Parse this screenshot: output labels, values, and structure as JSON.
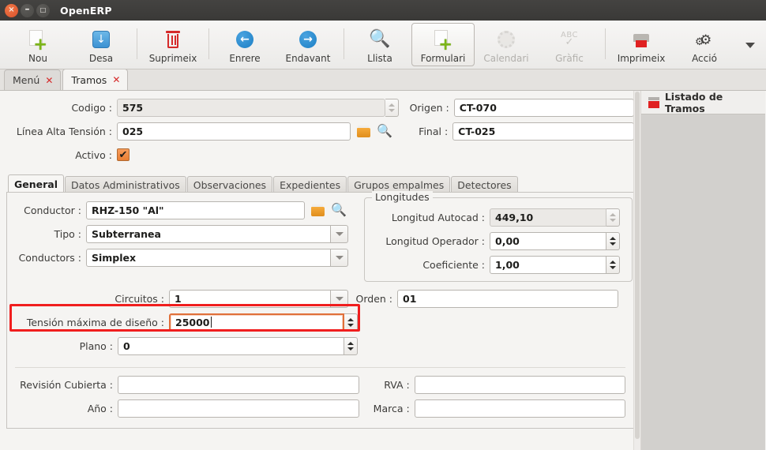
{
  "window": {
    "title": "OpenERP",
    "buttons": [
      {
        "name": "close",
        "glyph": "×"
      },
      {
        "name": "minimize",
        "glyph": "–"
      },
      {
        "name": "maximize",
        "glyph": "□"
      }
    ]
  },
  "toolbar": {
    "items": [
      {
        "label": "Nou",
        "icon": "new-document-icon",
        "enabled": true,
        "active": false
      },
      {
        "label": "Desa",
        "icon": "save-icon",
        "enabled": true,
        "active": false
      },
      {
        "label": "Suprimeix",
        "icon": "trash-icon",
        "enabled": true,
        "active": false
      },
      {
        "label": "Enrere",
        "icon": "arrow-left-icon",
        "enabled": true,
        "active": false
      },
      {
        "label": "Endavant",
        "icon": "arrow-right-icon",
        "enabled": true,
        "active": false
      },
      {
        "label": "Llista",
        "icon": "list-search-icon",
        "enabled": true,
        "active": false
      },
      {
        "label": "Formulari",
        "icon": "form-icon",
        "enabled": true,
        "active": true
      },
      {
        "label": "Calendari",
        "icon": "calendar-icon",
        "enabled": false,
        "active": false
      },
      {
        "label": "Gràfic",
        "icon": "graph-abc-icon",
        "enabled": false,
        "active": false
      },
      {
        "label": "Imprimeix",
        "icon": "printer-icon",
        "enabled": true,
        "active": false
      },
      {
        "label": "Acció",
        "icon": "gears-icon",
        "enabled": true,
        "active": false
      }
    ],
    "overflow_icon": "chevron-down-icon"
  },
  "page_tabs": [
    {
      "label": "Menú",
      "selected": false,
      "close_glyph": "✕"
    },
    {
      "label": "Tramos",
      "selected": true,
      "close_glyph": "✕"
    }
  ],
  "header_fields": {
    "codigo": {
      "label": "Codigo :",
      "value": "575",
      "readonly": true
    },
    "linea": {
      "label": "Línea Alta Tensión :",
      "value": "025",
      "readonly": false
    },
    "activo": {
      "label": "Activo :",
      "checked": true,
      "check_glyph": "✔"
    },
    "origen": {
      "label": "Origen :",
      "value": "CT-070"
    },
    "final": {
      "label": "Final :",
      "value": "CT-025"
    }
  },
  "notebook_tabs": [
    {
      "label": "General",
      "selected": true
    },
    {
      "label": "Datos Administrativos",
      "selected": false
    },
    {
      "label": "Observaciones",
      "selected": false
    },
    {
      "label": "Expedientes",
      "selected": false
    },
    {
      "label": "Grupos empalmes",
      "selected": false
    },
    {
      "label": "Detectores",
      "selected": false
    }
  ],
  "general_tab": {
    "conductor": {
      "label": "Conductor :",
      "value": "RHZ-150 \"Al\""
    },
    "tipo": {
      "label": "Tipo :",
      "value": "Subterranea"
    },
    "conductors": {
      "label": "Conductors :",
      "value": "Simplex"
    },
    "circuitos": {
      "label": "Circuitos :",
      "value": "1"
    },
    "tension": {
      "label": "Tensión máxima de diseño :",
      "value": "25000",
      "focused": true,
      "highlighted": true
    },
    "plano": {
      "label": "Plano :",
      "value": "0"
    },
    "orden": {
      "label": "Orden :",
      "value": "01"
    },
    "longitudes": {
      "title": "Longitudes",
      "autocad": {
        "label": "Longitud Autocad :",
        "value": "449,10",
        "readonly": true
      },
      "operador": {
        "label": "Longitud Operador :",
        "value": "0,00",
        "readonly": false
      },
      "coeficiente": {
        "label": "Coeficiente :",
        "value": "1,00",
        "readonly": false
      }
    },
    "revision_cubierta": {
      "label": "Revisión Cubierta :",
      "value": ""
    },
    "ano": {
      "label": "Año :",
      "value": ""
    },
    "rva": {
      "label": "RVA :",
      "value": ""
    },
    "marca": {
      "label": "Marca :",
      "value": ""
    }
  },
  "sidebar": {
    "header_label": "Listado de Tramos",
    "header_icon": "report-list-icon"
  },
  "colors": {
    "titlebar": "#3d3c3a",
    "close_button": "#e0522c",
    "accent_teal": "#0f8f80",
    "highlight_red": "#f01e1e",
    "focus_orange": "#e0703a",
    "checkbox_orange": "#ea7e33",
    "folder_orange": "#e89a23"
  }
}
